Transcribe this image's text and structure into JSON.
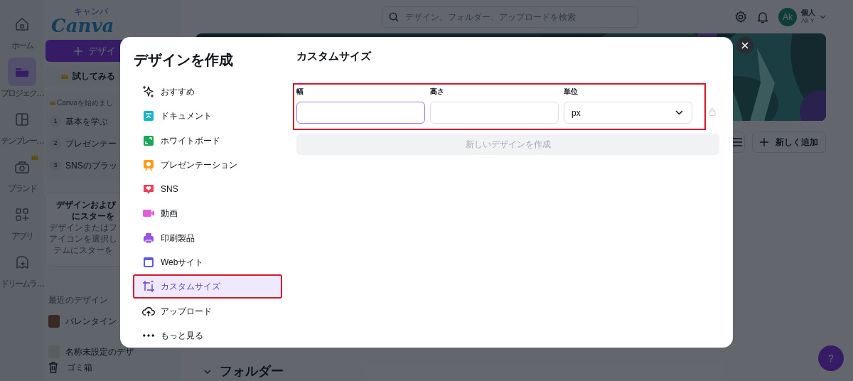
{
  "rail": [
    {
      "kind": "home",
      "label": "ホーム",
      "selected": false,
      "crown": false
    },
    {
      "kind": "folder",
      "label": "プロジェク…",
      "selected": true,
      "crown": false
    },
    {
      "kind": "template",
      "label": "テンプレー…",
      "selected": false,
      "crown": false
    },
    {
      "kind": "brand",
      "label": "ブランド",
      "selected": false,
      "crown": true
    },
    {
      "kind": "apps",
      "label": "アプリ",
      "selected": false,
      "crown": false
    },
    {
      "kind": "dream",
      "label": "ドリームラ…",
      "selected": false,
      "crown": false
    }
  ],
  "sidebar": {
    "logo_ruby": "キャンバ",
    "logo": "Canva",
    "create_button": "デザイ",
    "try_button": "試してみる",
    "getting_started": {
      "title": "Canvaを始めまし",
      "steps": [
        {
          "number": "1",
          "label": "基本を学ぶ"
        },
        {
          "number": "2",
          "label": "プレゼンテー"
        },
        {
          "number": "3",
          "label": "SNSのブラッ"
        }
      ]
    },
    "star_tip": {
      "title_lines": [
        "デザインおよび",
        "にスターを"
      ],
      "body_lines": [
        "デザインまたはフ",
        "アイコンを選択し",
        "テムにスターを"
      ]
    },
    "recent_title": "最近のデザイン",
    "recent": [
      {
        "label": "バレンタイン"
      },
      {
        "label": "名称未設定のデザ"
      }
    ],
    "trash": "ゴミ箱"
  },
  "header": {
    "search": {
      "placeholder": "デザイン、フォルダー、アップロードを検索"
    },
    "account": {
      "avatar": "Ak",
      "plan": "個人",
      "name": "Ak Y"
    }
  },
  "toolbar": {
    "add_button": "新しく追加"
  },
  "folders_heading": "フォルダー",
  "help": "?",
  "modal": {
    "title": "デザインを作成",
    "menu": [
      {
        "kind": "sparkle",
        "label": "おすすめ",
        "selected": false,
        "highlighted": false
      },
      {
        "kind": "document",
        "label": "ドキュメント",
        "selected": false,
        "highlighted": false
      },
      {
        "kind": "whiteboard",
        "label": "ホワイトボード",
        "selected": false,
        "highlighted": false
      },
      {
        "kind": "presentation",
        "label": "プレゼンテーション",
        "selected": false,
        "highlighted": false
      },
      {
        "kind": "social",
        "label": "SNS",
        "selected": false,
        "highlighted": false
      },
      {
        "kind": "video",
        "label": "動画",
        "selected": false,
        "highlighted": false
      },
      {
        "kind": "print",
        "label": "印刷製品",
        "selected": false,
        "highlighted": false
      },
      {
        "kind": "website",
        "label": "Webサイト",
        "selected": false,
        "highlighted": false
      },
      {
        "kind": "custom",
        "label": "カスタムサイズ",
        "selected": true,
        "highlighted": true
      },
      {
        "kind": "upload",
        "label": "アップロード",
        "selected": false,
        "highlighted": false
      },
      {
        "kind": "more",
        "label": "もっと見る",
        "selected": false,
        "highlighted": false
      }
    ],
    "panel": {
      "title": "カスタムサイズ",
      "highlighted": true,
      "fields": [
        {
          "label": "幅",
          "focused": true
        },
        {
          "label": "高さ",
          "focused": false
        }
      ],
      "unit": {
        "label": "単位",
        "value": "px"
      },
      "submit": {
        "label": "新しいデザインを作成",
        "disabled": true
      }
    }
  }
}
